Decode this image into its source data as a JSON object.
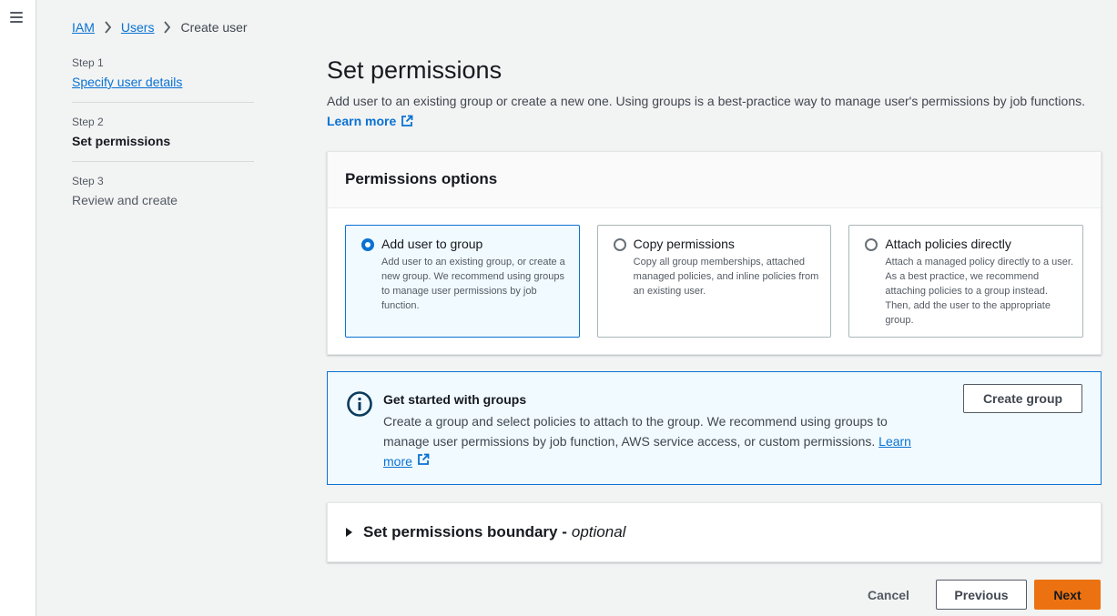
{
  "breadcrumb": {
    "items": [
      "IAM",
      "Users",
      "Create user"
    ]
  },
  "steps": [
    {
      "num": "Step 1",
      "title": "Specify user details"
    },
    {
      "num": "Step 2",
      "title": "Set permissions"
    },
    {
      "num": "Step 3",
      "title": "Review and create"
    }
  ],
  "page": {
    "title": "Set permissions",
    "description": "Add user to an existing group or create a new one. Using groups is a best-practice way to manage user's permissions by job functions.",
    "learn_more": "Learn more"
  },
  "permissions": {
    "heading": "Permissions options",
    "options": [
      {
        "title": "Add user to group",
        "desc": "Add user to an existing group, or create a new group. We recommend using groups to manage user permissions by job function.",
        "selected": true
      },
      {
        "title": "Copy permissions",
        "desc": "Copy all group memberships, attached managed policies, and inline policies from an existing user.",
        "selected": false
      },
      {
        "title": "Attach policies directly",
        "desc": "Attach a managed policy directly to a user. As a best practice, we recommend attaching policies to a group instead. Then, add the user to the appropriate group.",
        "selected": false
      }
    ]
  },
  "info": {
    "title": "Get started with groups",
    "text": "Create a group and select policies to attach to the group. We recommend using groups to manage user permissions by job function, AWS service access, or custom permissions.",
    "link": "Learn more",
    "button": "Create group"
  },
  "boundary": {
    "label": "Set permissions boundary -",
    "optional": "optional"
  },
  "footer": {
    "cancel": "Cancel",
    "previous": "Previous",
    "next": "Next"
  },
  "colors": {
    "link": "#0972d3",
    "primary": "#ec7211",
    "selected_bg": "#f1faff"
  },
  "icons": [
    "menu-icon",
    "chevron-right-icon",
    "external-link-icon",
    "info-icon",
    "caret-right-icon"
  ]
}
